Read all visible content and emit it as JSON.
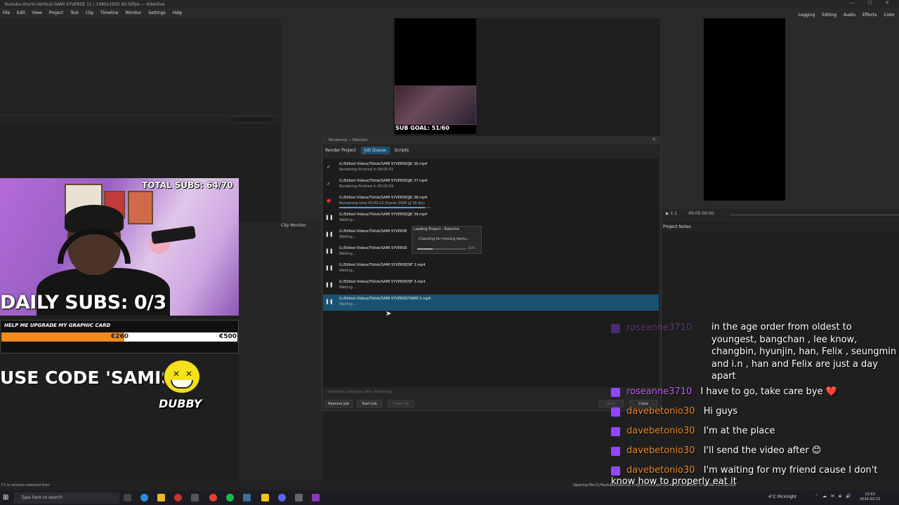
{
  "window": {
    "title": "Youtube-shorts-Vertical-SAMI SYVERSE 11 / 1080x1920 60.00fps — Kdenlive",
    "menu": [
      "File",
      "Edit",
      "View",
      "Project",
      "Tool",
      "Clip",
      "Timeline",
      "Monitor",
      "Settings",
      "Help"
    ],
    "workspaces": [
      "Logging",
      "Editing",
      "Audio",
      "Effects",
      "Color"
    ],
    "controls": "— ☐ ✕"
  },
  "panels": {
    "bin_search_placeholder": "...",
    "clip_monitor_tab": "Clip Monitor",
    "project_notes_tab": "Project Notes",
    "monitor_zoom": "1:1",
    "timecode": "00:00:00:00",
    "status_left": "F2 to rename selected item",
    "status_right": "Opening file D:/Youtube/Kdenlive Projects/Youtube-shorts-Vertical-SAMI SYVERSE 11.kdenlive"
  },
  "overlay": {
    "sub_goal": "SUB GOAL: 51/60",
    "total_subs": "TOTAL SUBS: 64/70",
    "daily_subs": "DAILY SUBS: 0/3",
    "graphic_card_title": "HELP ME UPGRADE MY GRAPHIC CARD",
    "graphic_card_current": "€260",
    "graphic_card_target": "€500",
    "graphic_card_progress": 0.52,
    "use_code": "USE CODE 'SAMISY'",
    "dubby": "DUBBY"
  },
  "render_dialog": {
    "title": "Rendering — Kdenlive",
    "tabs": [
      "Render Project",
      "Job Queue",
      "Scripts"
    ],
    "active_tab": "Job Queue",
    "jobs": [
      {
        "icon": "✓",
        "name": "G:/Edited Videos/Tiktok/SAMI SYVERSE/JJK 36.mp4",
        "status": "Rendering finished in 00:05:41"
      },
      {
        "icon": "✓",
        "name": "G:/Edited Videos/Tiktok/SAMI SYVERSE/JJK 37.mp4",
        "status": "Rendering finished in 00:02:54"
      },
      {
        "icon": "●",
        "name": "G:/Edited Videos/Tiktok/SAMI SYVERSE/JJK 38.mp4",
        "status": "Remaining time 00:00:12 (frame 2998 @ 16 fps)",
        "progress": 0.94
      },
      {
        "icon": "❚❚",
        "name": "G:/Edited Videos/Tiktok/SAMI SYVERSE/JJK 39.mp4",
        "status": "Waiting..."
      },
      {
        "icon": "❚❚",
        "name": "G:/Edited Videos/Tiktok/SAMI SYVERSE",
        "status": "Waiting..."
      },
      {
        "icon": "❚❚",
        "name": "G:/Edited Videos/Tiktok/SAMI SYVERSE",
        "status": "Waiting..."
      },
      {
        "icon": "❚❚",
        "name": "G:/Edited Videos/Tiktok/SAMI SYVERSE/NF 2.mp4",
        "status": "Waiting..."
      },
      {
        "icon": "❚❚",
        "name": "G:/Edited Videos/Tiktok/SAMI SYVERSE/NF 3.mp4",
        "status": "Waiting..."
      },
      {
        "icon": "❚❚",
        "name": "G:/Edited Videos/Tiktok/SAMI SYVERSE/YNME 5.mp4",
        "status": "Waiting..."
      }
    ],
    "loading_popup": {
      "title": "Loading Project - Kdenlive",
      "message": "Checking for missing items...",
      "percent_label": "31%",
      "progress": 0.31
    },
    "shutdown_label": "Shutdown computer after renderings",
    "buttons": {
      "remove": "Remove Job",
      "start": "Start Job",
      "cleanup": "Clean Up",
      "start_right": "Start",
      "close": "Close"
    }
  },
  "chat": {
    "faded_user": "roseanne3710",
    "wrapped_message": "in the age order from oldest to youngest, bangchan , lee know, changbin, hyunjin, han, Felix , seungmin and i.n , han and Felix are just a day apart",
    "lines": [
      {
        "user": "roseanne3710",
        "message": "I have to go, take care bye ❤️",
        "color": "purple"
      },
      {
        "user": "davebetonio30",
        "message": "Hi guys",
        "color": "orange"
      },
      {
        "user": "davebetonio30",
        "message": "I'm at the place",
        "color": "orange"
      },
      {
        "user": "davebetonio30",
        "message": "I'll send the video after 😊",
        "color": "orange"
      },
      {
        "user": "davebetonio30",
        "message": "I'm waiting for my friend cause I don't know how to properly eat it",
        "color": "orange"
      }
    ]
  },
  "taskbar": {
    "search_placeholder": "Type here to search",
    "weather": "4°C Mcinlight",
    "time": "13:53",
    "date": "2024-03-13"
  }
}
